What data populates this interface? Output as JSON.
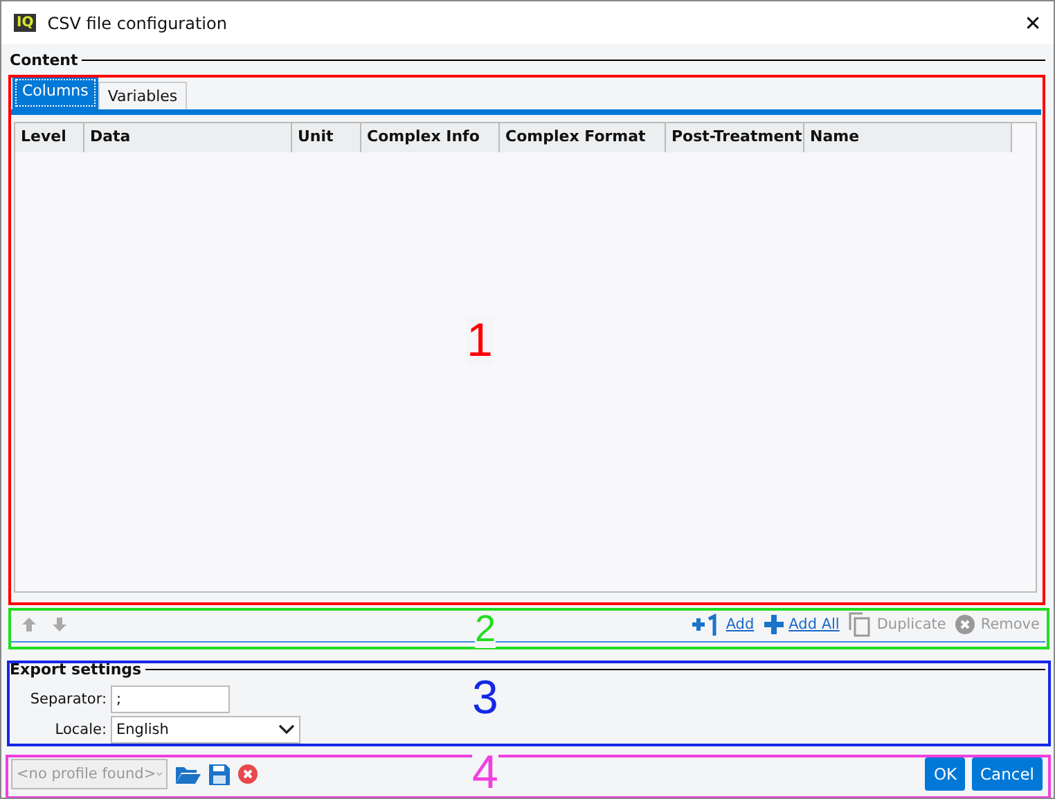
{
  "window": {
    "title": "CSV file configuration",
    "logo": "IQ",
    "close": "✕"
  },
  "content": {
    "legend": "Content",
    "tabs": [
      {
        "label": "Columns",
        "selected": true
      },
      {
        "label": "Variables",
        "selected": false
      }
    ],
    "table": {
      "columns": [
        "Level",
        "Data",
        "Unit",
        "Complex Info",
        "Complex Format",
        "Post-Treatment",
        "Name"
      ]
    }
  },
  "toolbar": {
    "moves": [
      {
        "kind": "up",
        "disabled": true
      },
      {
        "kind": "down",
        "disabled": true
      }
    ],
    "actions": [
      {
        "kind": "add",
        "label": "Add",
        "disabled": false
      },
      {
        "kind": "add-all",
        "label": "Add All",
        "disabled": false
      },
      {
        "kind": "duplicate",
        "label": "Duplicate",
        "disabled": true
      },
      {
        "kind": "remove",
        "label": "Remove",
        "disabled": true
      }
    ]
  },
  "export_settings": {
    "legend": "Export settings",
    "separator": {
      "label": "Separator:",
      "value": ";"
    },
    "locale": {
      "label": "Locale:",
      "value": "English"
    }
  },
  "footer": {
    "profile": {
      "value": "<no profile found>",
      "disabled": true
    },
    "buttons": [
      "OK",
      "Cancel"
    ]
  },
  "annotations": [
    {
      "label": "1",
      "color": "#ff0000"
    },
    {
      "label": "2",
      "color": "#22dd22"
    },
    {
      "label": "3",
      "color": "#1428e6"
    },
    {
      "label": "4",
      "color": "#f040e0"
    }
  ]
}
